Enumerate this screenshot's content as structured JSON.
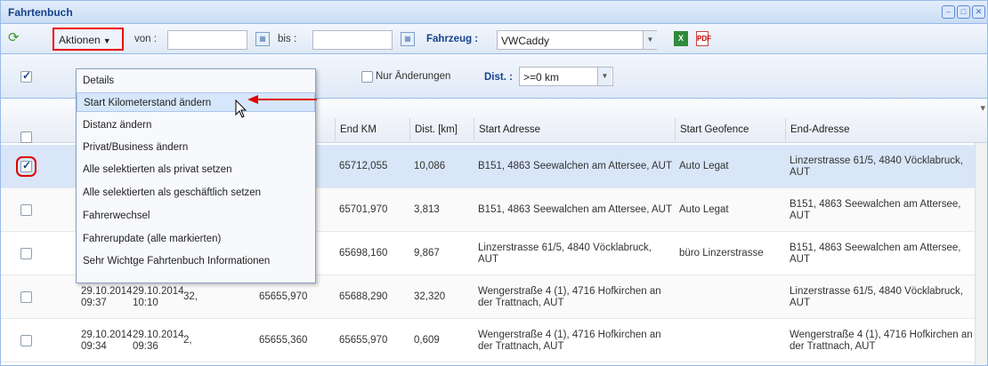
{
  "window": {
    "title": "Fahrtenbuch",
    "buttons": [
      "–",
      "□",
      "✕"
    ]
  },
  "toolbar": {
    "refresh_icon": "refresh-icon",
    "actions_label": "Aktionen",
    "von_label": "von :",
    "von_value": "",
    "bis_label": "bis :",
    "bis_value": "",
    "fahrzeug_label": "Fahrzeug :",
    "fahrzeug_value": "VWCaddy",
    "excel_icon": "excel-export-icon",
    "pdf_icon": "pdf-export-icon"
  },
  "filter": {
    "nur_aenderungen": "Nur Änderungen",
    "dist_label": "Dist. :",
    "dist_value": ">=0 km"
  },
  "menu": {
    "items": [
      "Details",
      "Start Kilometerstand ändern",
      "Distanz ändern",
      "Privat/Business ändern",
      "Alle selektierten als privat setzen",
      "Alle selektierten als geschäftlich setzen",
      "Fahrerwechsel",
      "Fahrerupdate (alle markierten)",
      "Sehr Wichtge Fahrtenbuch Informationen"
    ],
    "highlighted_index": 1
  },
  "grid": {
    "columns": [
      "End KM",
      "Dist. [km]",
      "Start Adresse",
      "Start Geofence",
      "End-Adresse"
    ],
    "rows": [
      {
        "checked": true,
        "start": "",
        "start_time": "",
        "end": "",
        "end_time": "",
        "dauer": "",
        "start_km": "",
        "end_km": "65712,055",
        "dist": "10,086",
        "start_adr": "B151, 4863 Seewalchen am Attersee, AUT",
        "geofence": "Auto Legat",
        "end_adr": "Linzerstrasse 61/5, 4840 Vöcklabruck, AUT"
      },
      {
        "checked": false,
        "start": "",
        "start_time": "",
        "end": "",
        "end_time": "",
        "dauer": "",
        "start_km": "",
        "end_km": "65701,970",
        "dist": "3,813",
        "start_adr": "B151, 4863 Seewalchen am Attersee, AUT",
        "geofence": "Auto Legat",
        "end_adr": "B151, 4863 Seewalchen am Attersee, AUT"
      },
      {
        "checked": false,
        "start": "",
        "start_time": "",
        "end": "",
        "end_time": "",
        "dauer": "",
        "start_km": "",
        "end_km": "65698,160",
        "dist": "9,867",
        "start_adr": "Linzerstrasse 61/5, 4840 Vöcklabruck, AUT",
        "geofence": "büro Linzerstrasse",
        "end_adr": "B151, 4863 Seewalchen am Attersee, AUT"
      },
      {
        "checked": false,
        "start": "29.10.2014",
        "start_time": "09:37",
        "end": "29.10.2014",
        "end_time": "10:10",
        "dauer": "32,",
        "start_km": "65655,970",
        "end_km": "65688,290",
        "dist": "32,320",
        "start_adr": "Wengerstraße 4 (1), 4716 Hofkirchen an der Trattnach, AUT",
        "geofence": "",
        "end_adr": "Linzerstrasse 61/5, 4840 Vöcklabruck, AUT"
      },
      {
        "checked": false,
        "start": "29.10.2014",
        "start_time": "09:34",
        "end": "29.10.2014",
        "end_time": "09:36",
        "dauer": "2,",
        "start_km": "65655,360",
        "end_km": "65655,970",
        "dist": "0,609",
        "start_adr": "Wengerstraße 4 (1), 4716 Hofkirchen an der Trattnach, AUT",
        "geofence": "",
        "end_adr": "Wengerstraße 4 (1), 4716 Hofkirchen an der Trattnach, AUT"
      }
    ]
  },
  "colors": {
    "highlight": "#d7e7fb",
    "annotation_red": "#e00000",
    "header_blue": "#15428b"
  }
}
